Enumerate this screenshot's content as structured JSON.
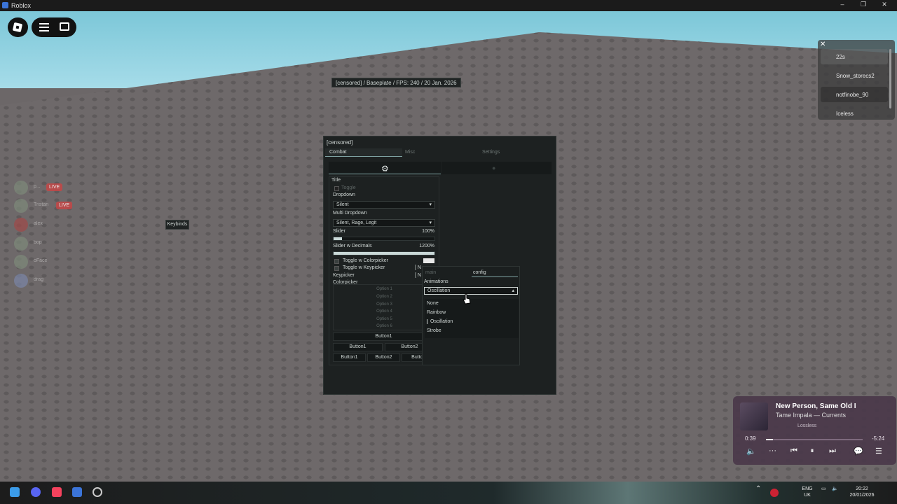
{
  "window": {
    "title": "Roblox",
    "min": "–",
    "max": "❐",
    "close": "✕"
  },
  "stats_text": "[censored] / Baseplate / FPS: 240 / 20 Jan. 2026",
  "keybinds_label": "Keybinds",
  "left_players": [
    {
      "name": "p...",
      "live": "LIVE"
    },
    {
      "name": "Tristan",
      "live": "LIVE"
    },
    {
      "name": "alex",
      "live": ""
    },
    {
      "name": "bop",
      "live": ""
    },
    {
      "name": "oFace",
      "live": ""
    },
    {
      "name": "drag",
      "live": ""
    }
  ],
  "player_panel": {
    "close": "✕",
    "players": [
      "22s",
      "Snow_storecs2",
      "notfinobe_90",
      "Iceless"
    ]
  },
  "gui": {
    "header": "[censored]",
    "tabs": [
      "Combat",
      "Misc",
      "Settings"
    ],
    "section_title": "Title",
    "toggle_label": "Toggle",
    "dropdown_label": "Dropdown",
    "dropdown_value": "Silent",
    "multi_label": "Multi Dropdown",
    "multi_value": "Silent, Rage, Legit",
    "slider_label": "Slider",
    "slider_value": "100%",
    "slider_fill": 0.08,
    "slider_dec_label": "Slider w Decimals",
    "slider_dec_value": "1200%",
    "slider_dec_fill": 1.0,
    "toggle_color_label": "Toggle w Colorpicker",
    "toggle_key_label": "Toggle w Keypicker",
    "keypicker_label": "Keypicker",
    "colorpicker_label": "Colorpicker",
    "key_text_1": "[ N",
    "key_text_2": "[ N",
    "options": [
      "Option 1",
      "Option 2",
      "Option 3",
      "Option 4",
      "Option 5",
      "Option 6"
    ],
    "button1": "Button1",
    "row2": [
      "Button1",
      "Button2"
    ],
    "row3": [
      "Button1",
      "Button2",
      "Buttor"
    ]
  },
  "overlay": {
    "tab_main": "main",
    "tab_config": "config",
    "animations_label": "Animations",
    "selected": "Oscillation",
    "items": [
      "None",
      "Rainbow",
      "Oscillation",
      "Strobe"
    ]
  },
  "music": {
    "title": "New Person, Same Old I",
    "artist": "Tame Impala — Currents",
    "quality": "Lossless",
    "elapsed": "0:39",
    "remaining": "-5:24",
    "progress": 0.07
  },
  "tray": {
    "lang": "ENG",
    "region": "UK",
    "time": "20:22",
    "date": "20/01/2026"
  },
  "colors": {
    "accent": "#7fa3a3",
    "panel": "#1d2121",
    "live": "#c54646"
  }
}
